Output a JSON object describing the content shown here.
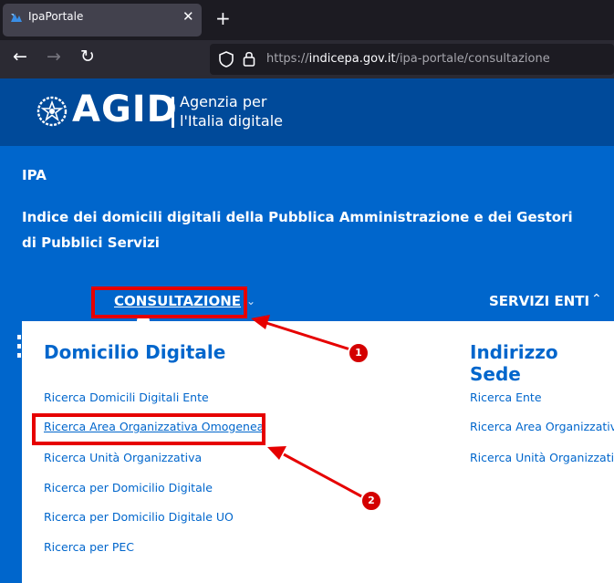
{
  "browser": {
    "tab_title": "IpaPortale",
    "tab_close": "✕",
    "new_tab": "+",
    "back": "←",
    "forward": "→",
    "reload": "↻",
    "url_prefix": "https://",
    "url_domain": "indicepa.gov.it",
    "url_path": "/ipa-portale/consultazione"
  },
  "header": {
    "logo_text": "AGID",
    "logo_sub_line1": "Agenzia per",
    "logo_sub_line2": "l'Italia digitale"
  },
  "hero": {
    "short_title": "IPA",
    "title": "Indice dei domicili digitali della Pubblica Amministrazione e dei Gestori di Pubblici Servizi"
  },
  "nav": {
    "consultazione": "CONSULTAZIONE",
    "consultazione_chevron": "⌄",
    "servizi_enti": "SERVIZI ENTI",
    "servizi_chevron": "⌃"
  },
  "menu": {
    "domicilio": {
      "title": "Domicilio Digitale",
      "items": [
        "Ricerca Domicili Digitali Ente",
        "Ricerca Area Organizzativa Omogenea",
        "Ricerca Unità Organizzativa",
        "Ricerca per Domicilio Digitale",
        "Ricerca per Domicilio Digitale UO",
        "Ricerca per PEC"
      ]
    },
    "sede": {
      "title": "Indirizzo Sede",
      "items": [
        "Ricerca Ente",
        "Ricerca Area Organizzativa Omogenea",
        "Ricerca Unità Organizzativa"
      ]
    }
  },
  "annotations": {
    "badge1": "1",
    "badge2": "2",
    "color": "#e60000"
  },
  "colors": {
    "brand_dark": "#004a9a",
    "brand": "#0066cc",
    "link": "#0066cc"
  }
}
